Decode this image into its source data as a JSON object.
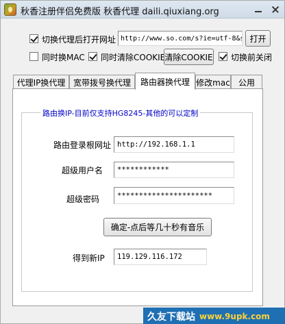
{
  "window": {
    "title": "秋香注册伴侣免费版 秋香代理 daili.qiuxiang.org"
  },
  "options": {
    "open_url_label": "切换代理后打开网址",
    "open_url_checked": true,
    "url_value": "http://www.so.com/s?ie=utf-8&s",
    "open_button": "打开",
    "sync_mac_label": "同时换MAC",
    "sync_mac_checked": false,
    "clear_cookie_label": "同时清除COOKIE",
    "clear_cookie_checked": true,
    "clear_cookie_button": "清除COOKIE",
    "close_before_label": "切换前关闭",
    "close_before_checked": true
  },
  "tabs": [
    {
      "label": "代理IP换代理"
    },
    {
      "label": "宽带拨号换代理"
    },
    {
      "label": "路由器换代理"
    },
    {
      "label": "修改mac"
    },
    {
      "label": "公用"
    }
  ],
  "router": {
    "group_title": "路由换IP-目前仅支持HG8245-其他的可以定制",
    "login_url_label": "路由登录根网址",
    "login_url_value": "http://192.168.1.1",
    "admin_user_label": "超级用户名",
    "admin_user_value": "************",
    "admin_pass_label": "超级密码",
    "admin_pass_value": "**********************",
    "confirm_button": "确定-点后等几十秒有音乐",
    "new_ip_label": "得到新IP",
    "new_ip_value": "119.129.116.172"
  },
  "watermark": {
    "cn": "久友下载站",
    "url": "www.9upk.com"
  }
}
